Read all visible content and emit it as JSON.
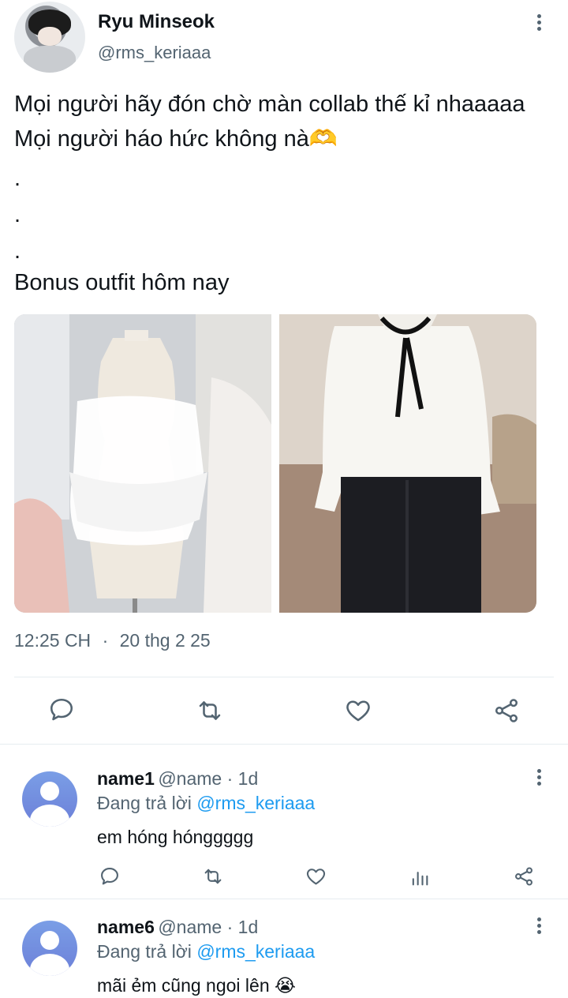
{
  "tweet": {
    "author_name": "Ryu Minseok",
    "author_handle": "@rms_keriaaa",
    "lines": [
      "Mọi người hãy đón chờ màn collab thế kỉ nhaaaaa",
      "Mọi người háo hức không nà🫶",
      ".",
      ".",
      ".",
      "Bonus outfit hôm nay"
    ],
    "time": "12:25 CH",
    "separator": "·",
    "date": "20 thg 2 25"
  },
  "actions": [
    "reply-icon",
    "retweet-icon",
    "like-icon",
    "share-icon"
  ],
  "replies": [
    {
      "name": "name1",
      "meta": "@name · 1d",
      "replying_prefix": "Đang trả lời ",
      "replying_to": "@rms_keriaaa",
      "text": "em hóng hónggggg"
    },
    {
      "name": "name6",
      "meta": "@name · 1d",
      "replying_prefix": "Đang trả lời ",
      "replying_to": "@rms_keriaaa",
      "text": "mãi ẻm cũng ngoi lên 😭"
    }
  ],
  "colors": {
    "accent": "#1d9bf0",
    "muted": "#536471",
    "text": "#0f1419"
  }
}
